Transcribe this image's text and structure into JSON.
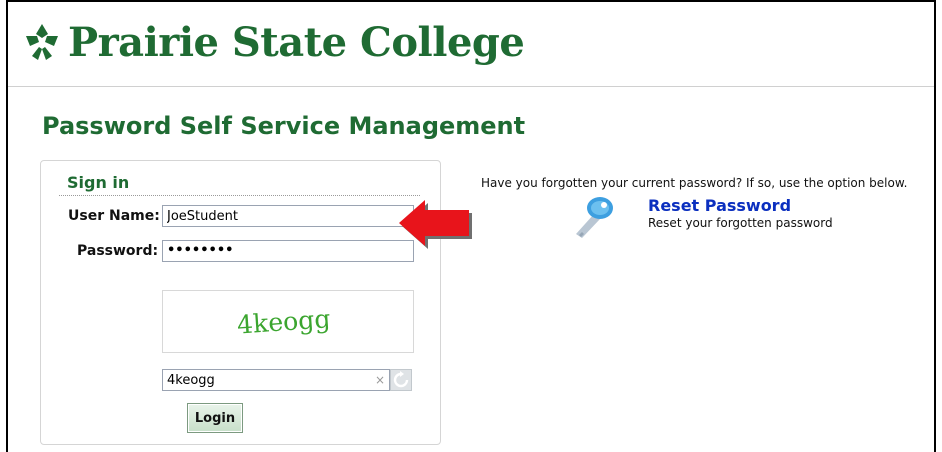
{
  "header": {
    "college_name": "Prairie State College",
    "logo_icon": "prairie-state-logo-icon",
    "brand_color": "#1f6b33"
  },
  "page": {
    "title": "Password Self Service Management"
  },
  "signin": {
    "title": "Sign in",
    "username_label": "User Name:",
    "username_value": "JoeStudent",
    "password_label": "Password:",
    "password_value": "••••••••",
    "captcha_image_text": "4keogg",
    "captcha_input_value": "4keogg",
    "clear_icon": "×",
    "refresh_icon": "refresh-icon",
    "login_label": "Login"
  },
  "reset": {
    "prompt": "Have you forgotten your current password?  If so, use the option below.",
    "link_label": "Reset Password",
    "description": "Reset your forgotten password",
    "icon": "key-icon",
    "link_color": "#0b2fbf"
  },
  "annotation": {
    "arrow_color": "#e8141b",
    "icon": "arrow-left-icon"
  }
}
